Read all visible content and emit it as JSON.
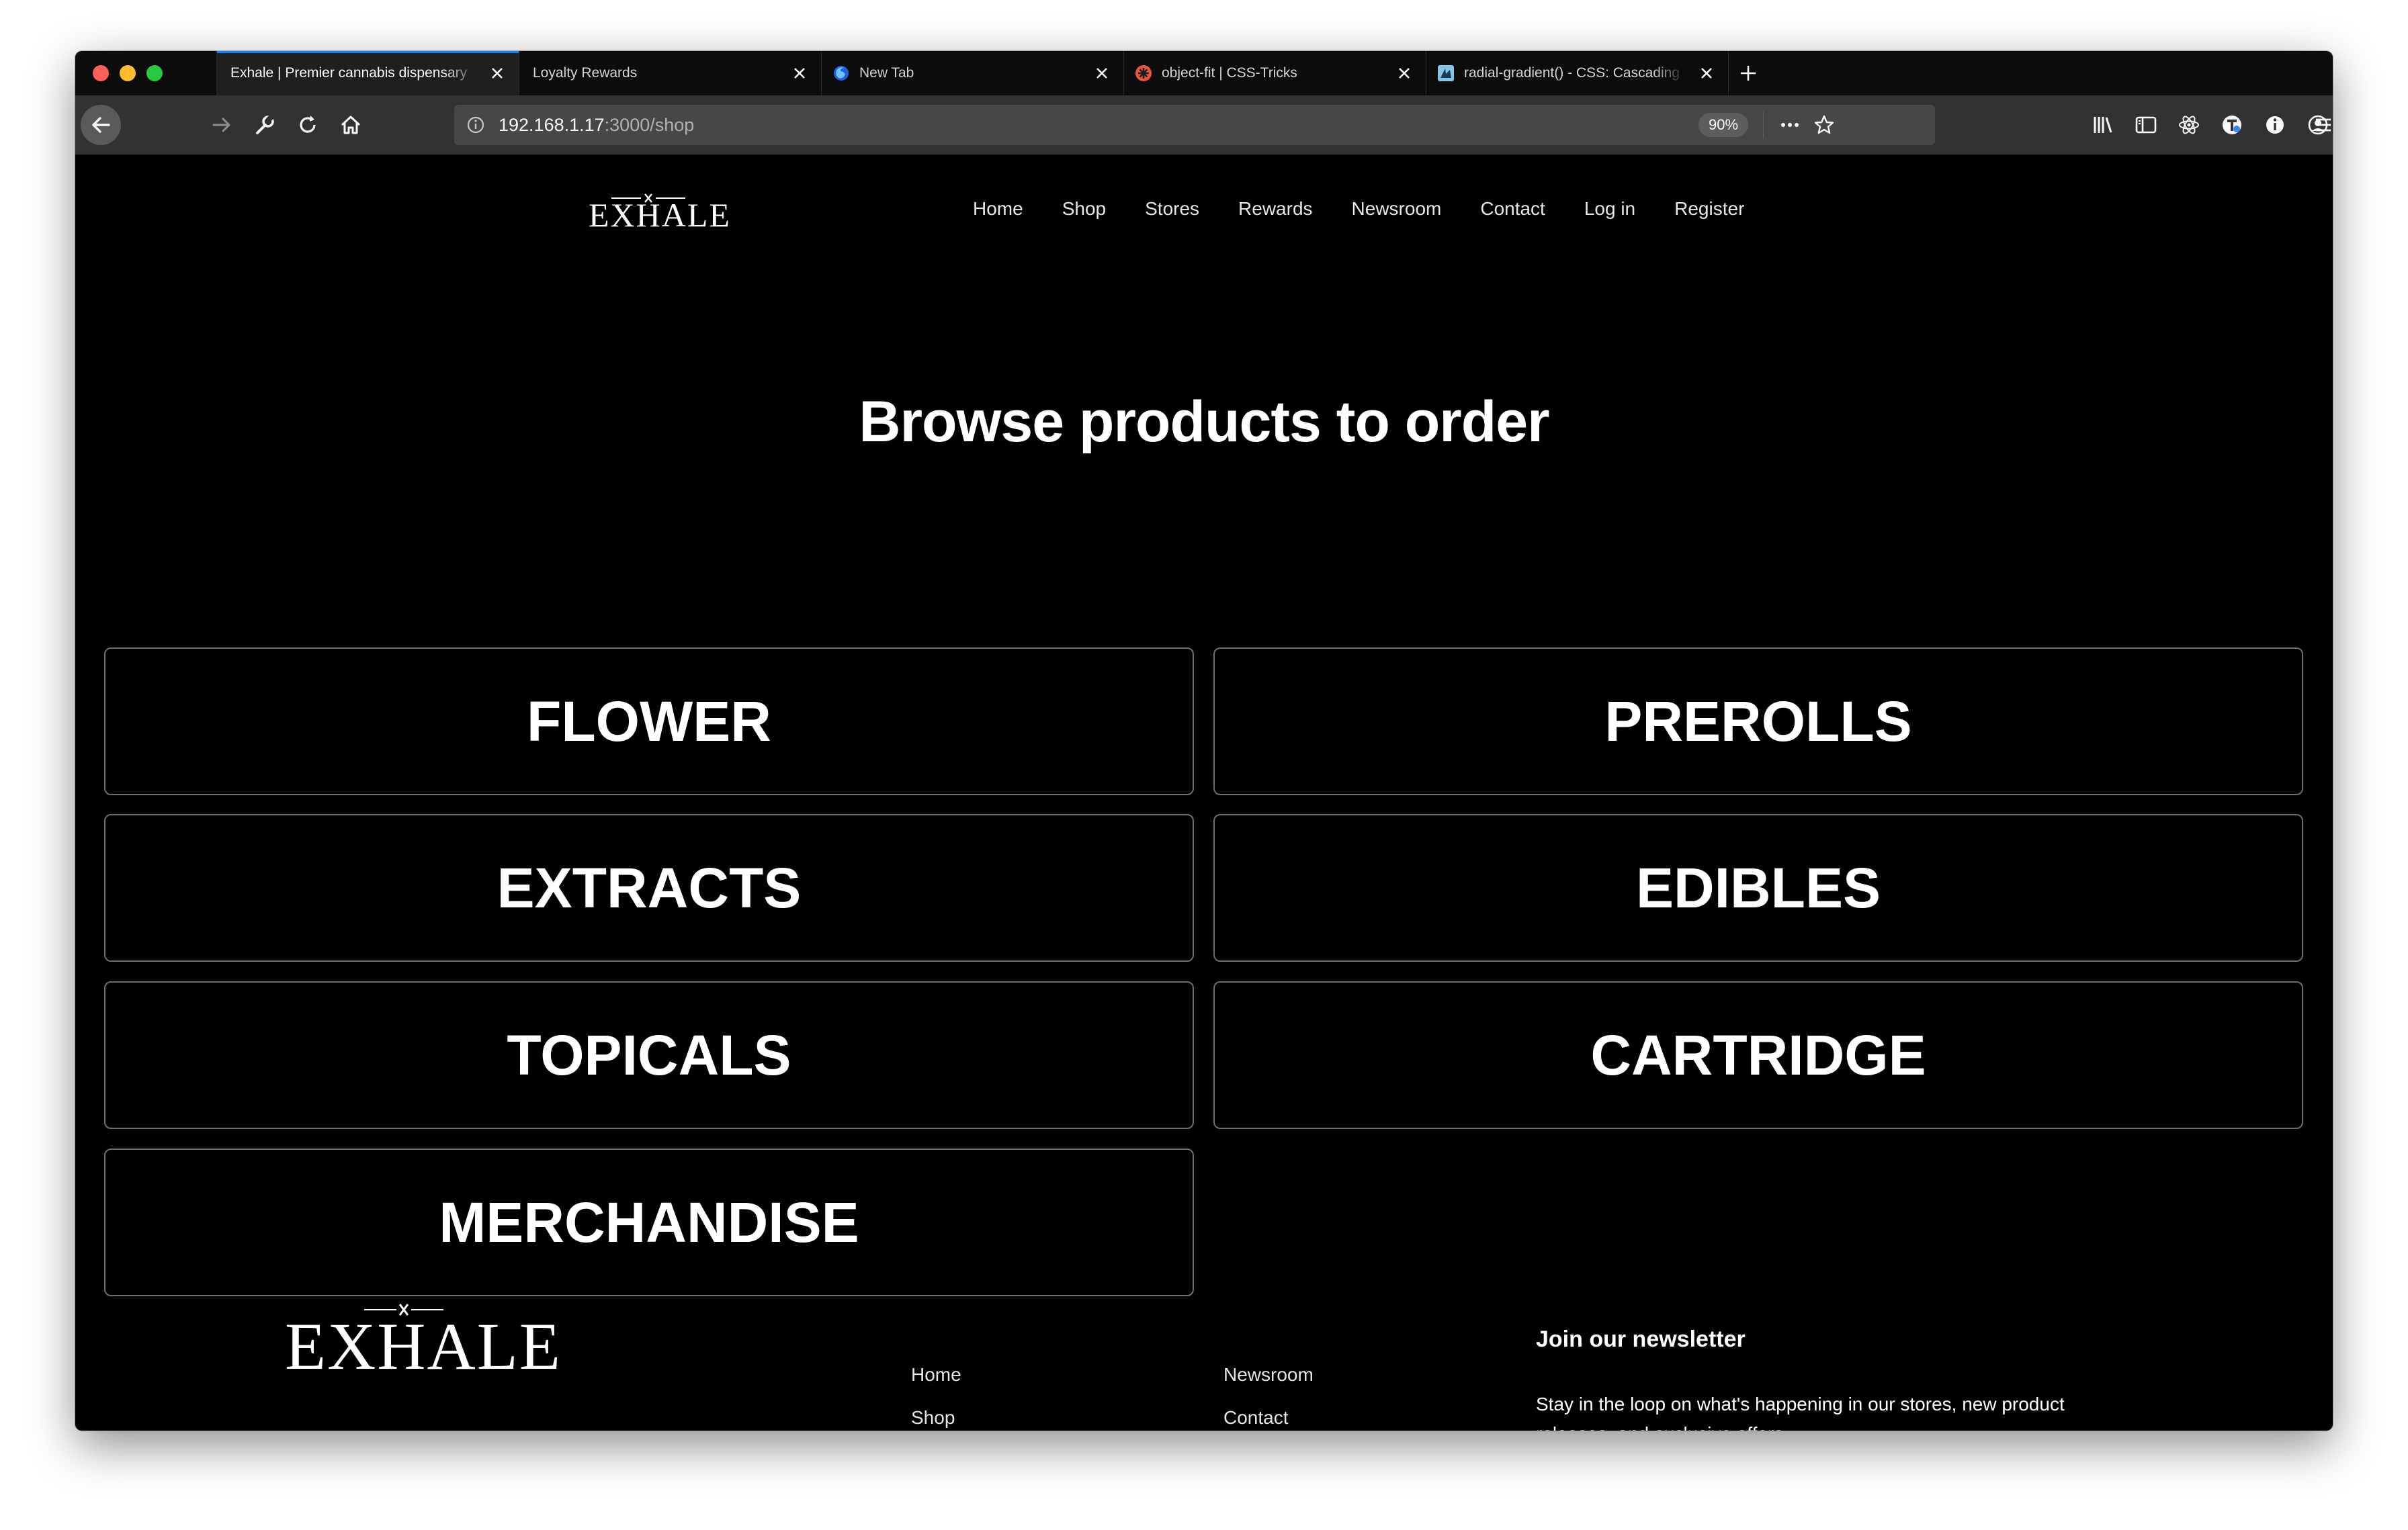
{
  "browser": {
    "tabs": [
      {
        "title": "Exhale | Premier cannabis dispensary",
        "active": true,
        "favicon": "none"
      },
      {
        "title": "Loyalty Rewards",
        "active": false,
        "favicon": "none"
      },
      {
        "title": "New Tab",
        "active": false,
        "favicon": "firefox-icon"
      },
      {
        "title": "object-fit | CSS-Tricks",
        "active": false,
        "favicon": "css-tricks-icon"
      },
      {
        "title": "radial-gradient() - CSS: Cascading Style Sheets",
        "active": false,
        "favicon": "mdn-icon"
      }
    ],
    "url_host": "192.168.1.17",
    "url_path": ":3000/shop",
    "zoom": "90%",
    "colors": {
      "chrome_dark": "#0c0c0d",
      "toolbar": "#323234",
      "urlbar": "#474749",
      "accent": "#0a84ff"
    }
  },
  "site": {
    "logo_text": "EXHALE",
    "nav": [
      {
        "label": "Home"
      },
      {
        "label": "Shop"
      },
      {
        "label": "Stores"
      },
      {
        "label": "Rewards"
      },
      {
        "label": "Newsroom"
      },
      {
        "label": "Contact"
      },
      {
        "label": "Log in"
      },
      {
        "label": "Register"
      }
    ],
    "headline": "Browse products to order",
    "categories": [
      {
        "label": "FLOWER"
      },
      {
        "label": "PREROLLS"
      },
      {
        "label": "EXTRACTS"
      },
      {
        "label": "EDIBLES"
      },
      {
        "label": "TOPICALS"
      },
      {
        "label": "CARTRIDGE"
      },
      {
        "label": "MERCHANDISE"
      }
    ],
    "footer": {
      "col1": [
        {
          "label": "Home"
        },
        {
          "label": "Shop"
        }
      ],
      "col2": [
        {
          "label": "Newsroom"
        },
        {
          "label": "Contact"
        }
      ],
      "newsletter_title": "Join our newsletter",
      "newsletter_text": "Stay in the loop on what's happening in our stores, new product releases, and exclusive offers."
    }
  }
}
